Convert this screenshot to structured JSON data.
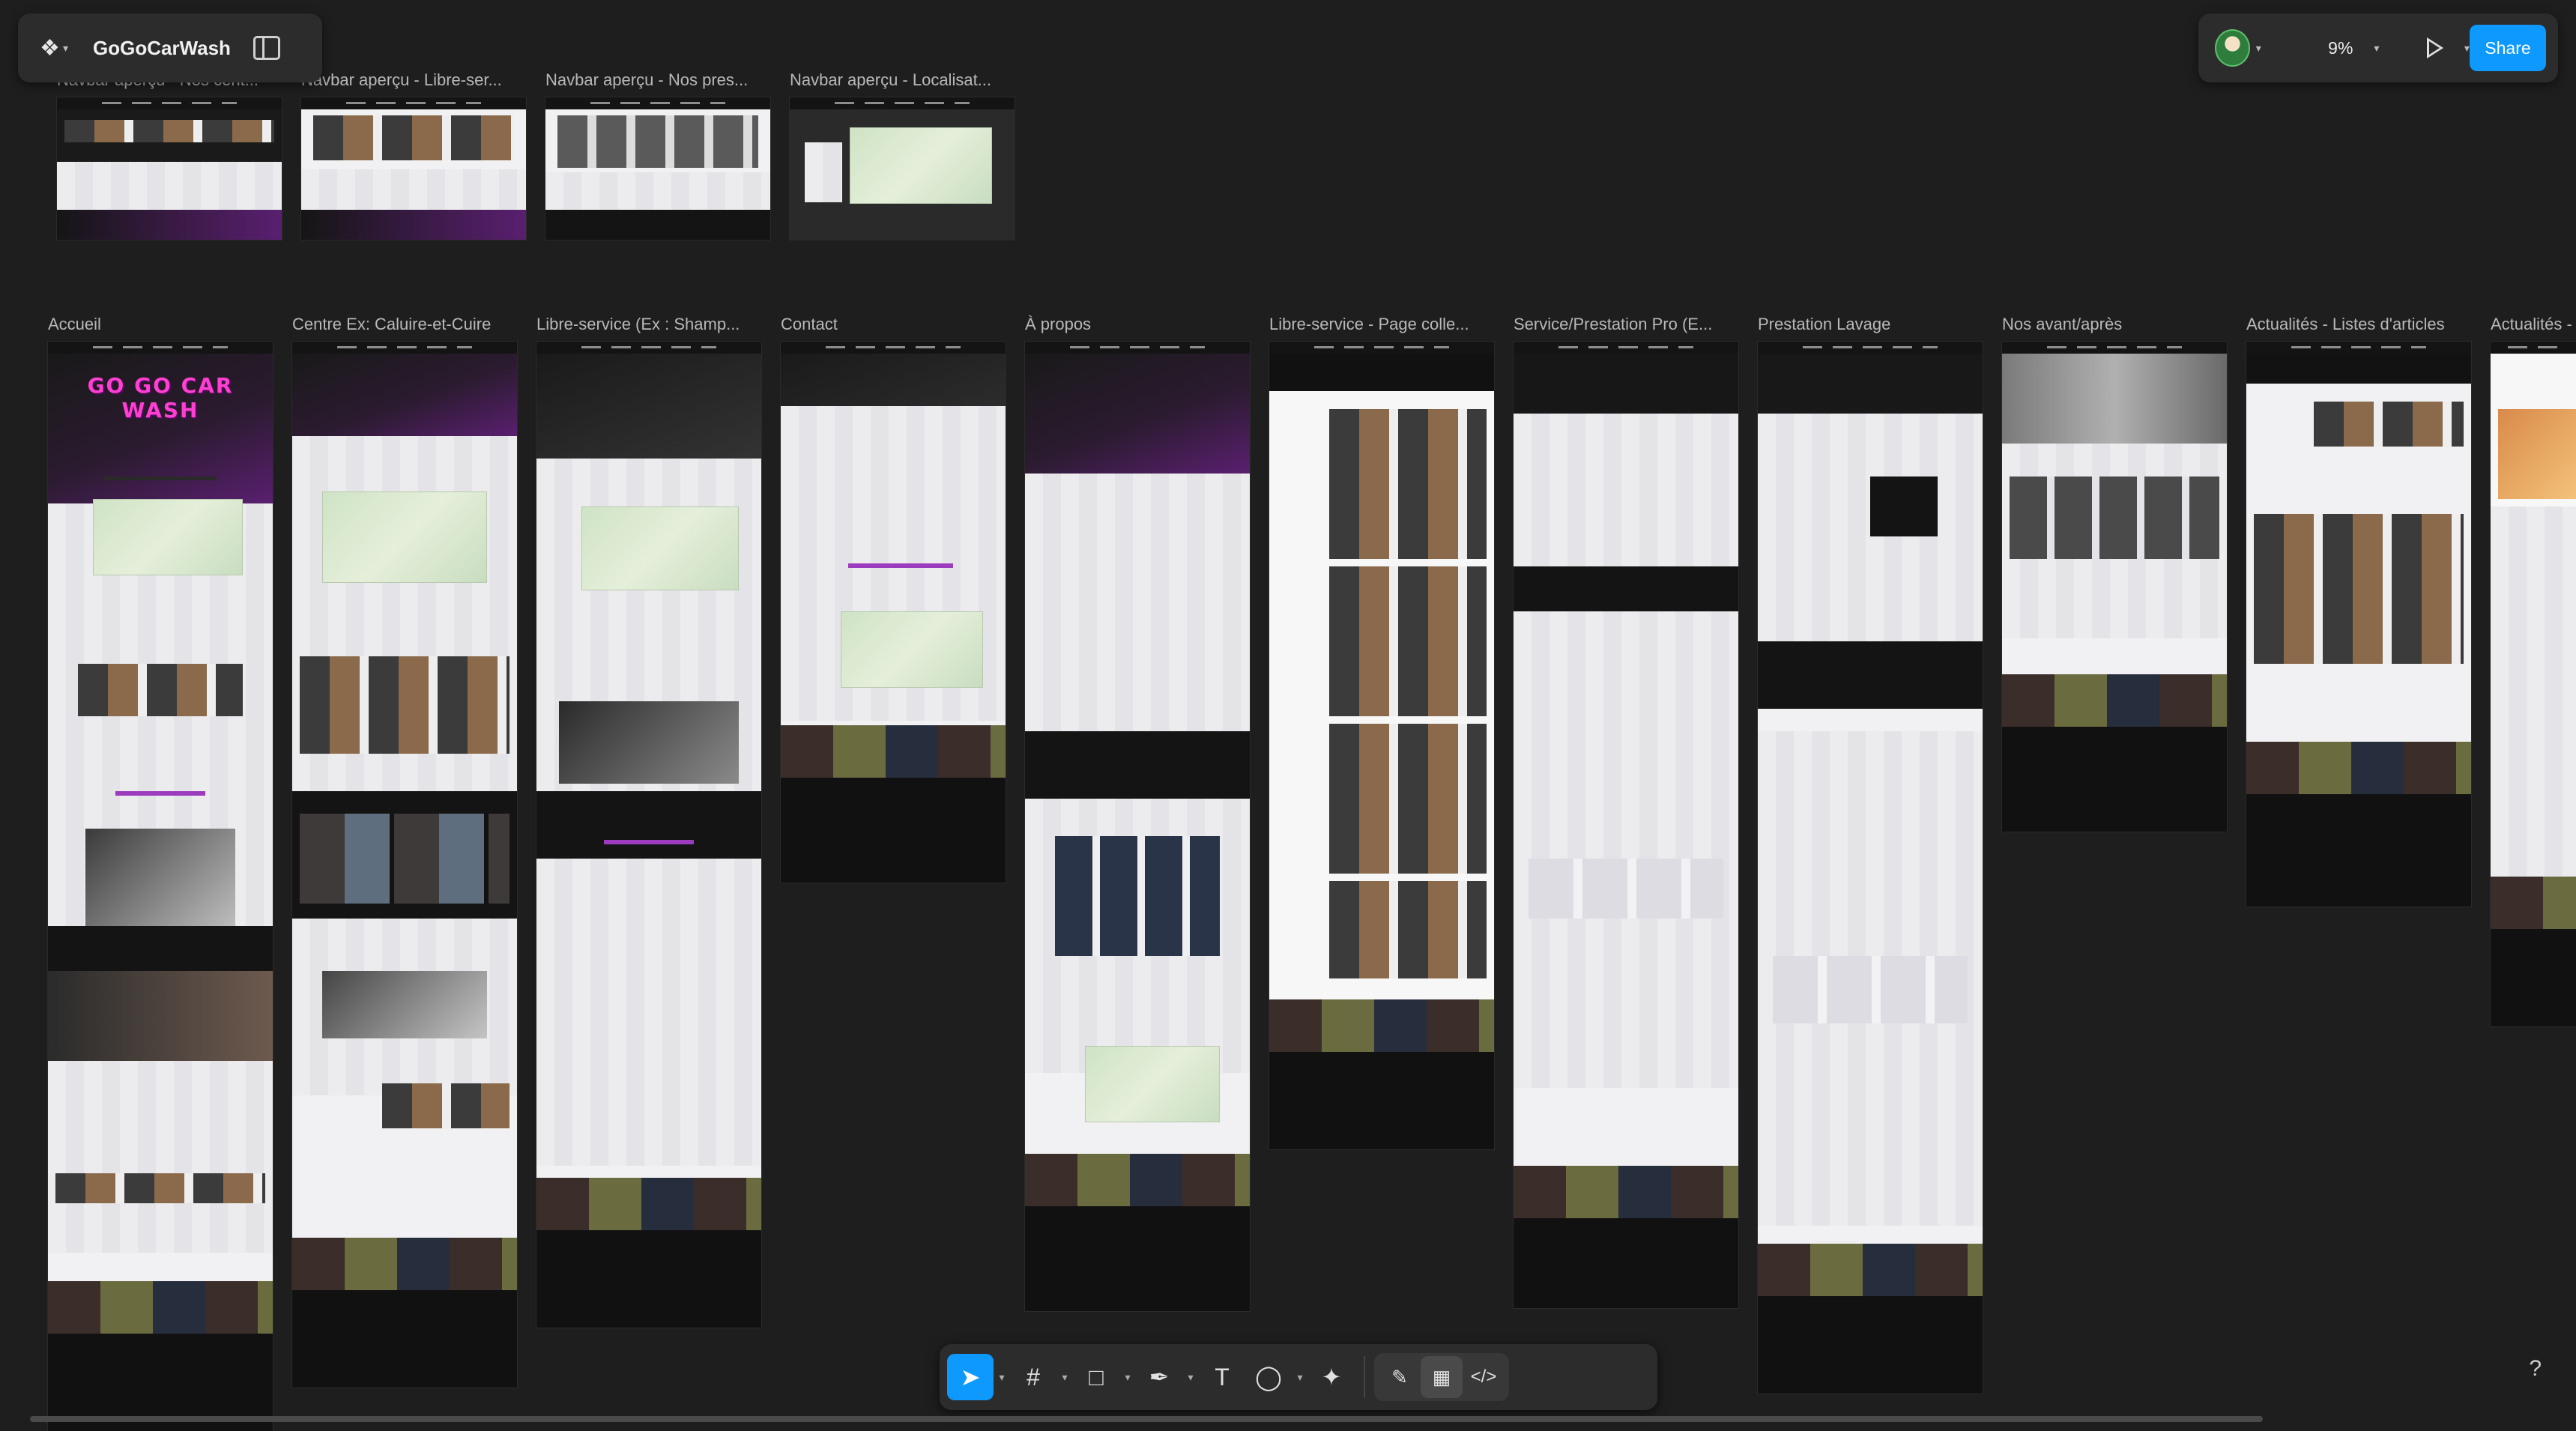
{
  "app": {
    "file_name": "GoGoCarWash"
  },
  "header": {
    "zoom": "9%",
    "share_label": "Share"
  },
  "top_frames": [
    {
      "label": "Navbar aperçu - Nos cent..."
    },
    {
      "label": "Navbar aperçu - Libre-ser..."
    },
    {
      "label": "Navbar aperçu - Nos pres..."
    },
    {
      "label": "Navbar aperçu - Localisat..."
    }
  ],
  "frames": [
    {
      "label": "Accueil",
      "hero_text": "GO GO CAR WASH"
    },
    {
      "label": "Centre Ex: Caluire-et-Cuire"
    },
    {
      "label": "Libre-service (Ex : Shamp..."
    },
    {
      "label": "Contact"
    },
    {
      "label": "À propos"
    },
    {
      "label": "Libre-service - Page colle..."
    },
    {
      "label": "Service/Prestation Pro (E..."
    },
    {
      "label": "Prestation Lavage"
    },
    {
      "label": "Nos avant/après"
    },
    {
      "label": "Actualités - Listes d'articles"
    },
    {
      "label": "Actualités -"
    }
  ],
  "icons": {
    "logo": "figma-logo-icon",
    "panel": "sidebar-toggle-icon",
    "present": "play-icon",
    "help": "help-icon"
  },
  "toolbar": {
    "tools": [
      "move-tool",
      "frame-tool",
      "shape-tool",
      "pen-tool",
      "text-tool",
      "comment-tool",
      "actions-tool"
    ],
    "help_label": "?"
  },
  "colors": {
    "canvas": "#1e1e1e",
    "accent": "#0d99ff",
    "brand_purple": "#9b3bbd",
    "brand_pink": "#ff3fd2"
  }
}
